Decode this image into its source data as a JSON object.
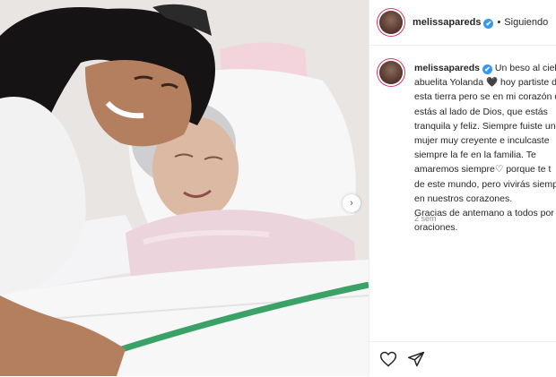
{
  "post": {
    "username": "melissapareds",
    "verified_mark": "✔",
    "separator": "•",
    "follow_label": "Siguiendo",
    "next_arrow": "›",
    "caption_username": "melissapareds",
    "caption_text": "Un beso al cielo\nabuelita Yolanda 🖤 hoy partiste d\nesta tierra pero se en mi corazón q\nestás al lado de Dios, que estás\ntranquila y feliz. Siempre fuiste un\nmujer muy creyente e inculcaste\nsiempre la fe en la familia. Te\namaremos siempre♡ porque te t\nde este mundo, pero vivirás siemp\nen nuestros corazones.\nGracias de antemano a todos por\noraciones.",
    "timestamp": "2 sem",
    "icons": {
      "verified": "verified-badge-icon",
      "like": "heart-icon",
      "share": "paper-plane-icon",
      "next": "chevron-right-icon"
    },
    "colors": {
      "accent": "#3897f0",
      "story_ring": "#d8356a",
      "muted": "#8e8e8e"
    }
  }
}
